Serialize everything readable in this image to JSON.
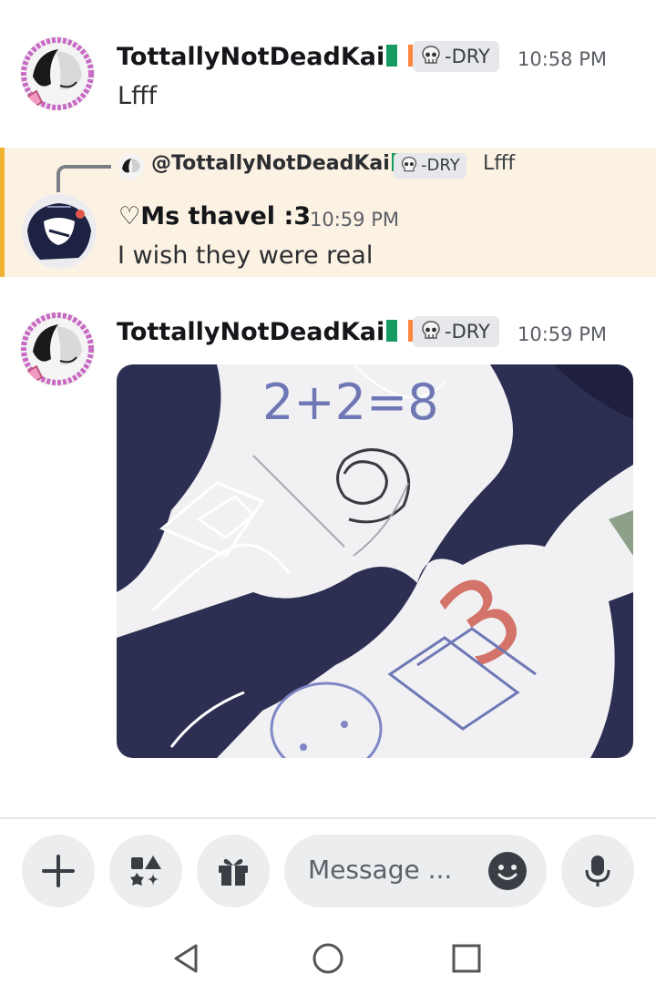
{
  "messages": [
    {
      "author": "TottallyNotDeadKai",
      "role_label": "-DRY",
      "time": "10:58 PM",
      "text": "Lfff"
    },
    {
      "reply_to": {
        "author": "@TottallyNotDeadKai",
        "role_label": "-DRY",
        "text": "Lfff"
      },
      "author": "♡Ms thavel :3",
      "time": "10:59 PM",
      "text": "I wish they were real"
    },
    {
      "author": "TottallyNotDeadKai",
      "role_label": "-DRY",
      "time": "10:59 PM",
      "attachment": {
        "scribble_text": "2+2=8",
        "scribble_number": "3"
      }
    }
  ],
  "composer": {
    "placeholder": "Message ...",
    "buttons": [
      "add-icon",
      "apps-icon",
      "gift-icon",
      "emoji-icon",
      "microphone-icon"
    ]
  },
  "navigation": {
    "buttons": [
      "back-icon",
      "home-icon",
      "recents-icon"
    ]
  },
  "colors": {
    "accent_reply": "#f0b232",
    "reply_background": "#fbf2e3",
    "flag_green": "#169b62",
    "flag_white": "#ffffff",
    "flag_orange": "#ff883e",
    "composer_background": "#ebedef"
  }
}
